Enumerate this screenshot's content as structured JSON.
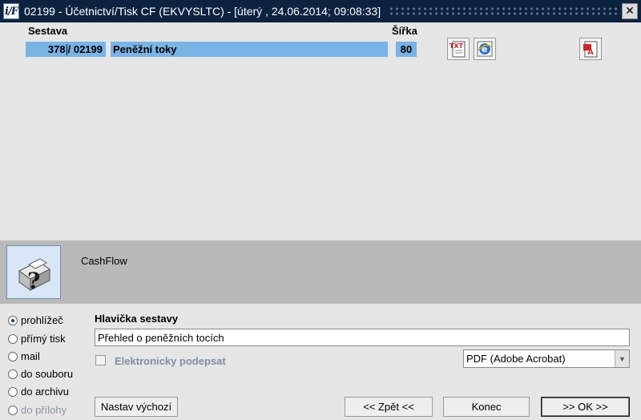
{
  "window": {
    "title": "02199 - Účetnictví/Tisk CF (EKVYSLTC) - [úterý  , 24.06.2014; 09:08:33]",
    "app_icon_text": "i/F",
    "close_glyph": "✕"
  },
  "report": {
    "label_sestava": "Sestava",
    "label_sirka": "Šířka",
    "number_left": "378",
    "number_right": "/ 02199",
    "name": "Peněžní toky",
    "width_value": "80"
  },
  "icons": {
    "txt": "txt-export-icon",
    "ie": "internet-explorer-icon",
    "pdf": "pdf-export-icon",
    "printer": "printer-help-icon"
  },
  "banner": {
    "text": "CashFlow"
  },
  "output_options": [
    {
      "label": "prohlížeč",
      "selected": true,
      "disabled": false
    },
    {
      "label": "přímý tisk",
      "selected": false,
      "disabled": false
    },
    {
      "label": "mail",
      "selected": false,
      "disabled": false
    },
    {
      "label": "do souboru",
      "selected": false,
      "disabled": false
    },
    {
      "label": "do archivu",
      "selected": false,
      "disabled": false
    },
    {
      "label": "do přílohy",
      "selected": false,
      "disabled": true
    }
  ],
  "form": {
    "header_label": "Hlavička sestavy",
    "header_value": "Přehled o peněžních tocích",
    "sign_label": "Elektronicky podepsat",
    "sign_checked": false,
    "format_value": "PDF (Adobe Acrobat)"
  },
  "buttons": {
    "defaults": "Nastav výchozí",
    "back": "<< Zpět <<",
    "end": "Konec",
    "ok": ">> OK >>"
  },
  "colors": {
    "titlebar": "#0c2340",
    "field_highlight": "#7ab3e6",
    "banner": "#b9b9b9",
    "pdf_red": "#d2232a"
  }
}
